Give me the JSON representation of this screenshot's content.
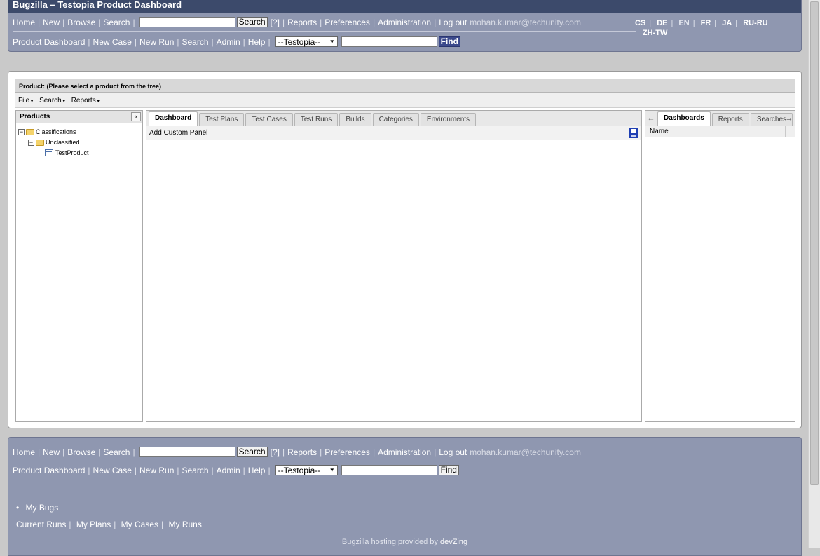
{
  "title": "Bugzilla – Testopia Product Dashboard",
  "nav": {
    "home": "Home",
    "new": "New",
    "browse": "Browse",
    "search": "Search",
    "search_button": "Search",
    "help": "[?]",
    "reports": "Reports",
    "preferences": "Preferences",
    "administration": "Administration",
    "logout": "Log out",
    "user": "mohan.kumar@techunity.com"
  },
  "testopia_nav": {
    "product_dashboard": "Product Dashboard",
    "new_case": "New Case",
    "new_run": "New Run",
    "search": "Search",
    "admin": "Admin",
    "help": "Help",
    "select_value": "--Testopia--",
    "find_button": "Find"
  },
  "languages": [
    "CS",
    "DE",
    "EN",
    "FR",
    "JA",
    "RU-RU",
    "ZH-TW"
  ],
  "product_header": "Product: (Please select a product from the tree)",
  "menu": {
    "file": "File",
    "search": "Search",
    "reports": "Reports"
  },
  "products_panel": {
    "title": "Products",
    "tree": {
      "root": "Classifications",
      "child": "Unclassified",
      "leaf": "TestProduct"
    }
  },
  "center_tabs": [
    "Dashboard",
    "Test Plans",
    "Test Cases",
    "Test Runs",
    "Builds",
    "Categories",
    "Environments"
  ],
  "center_toolbar": {
    "add_custom_panel": "Add Custom Panel"
  },
  "right_tabs": [
    "Dashboards",
    "Reports",
    "Searches"
  ],
  "right_grid": {
    "column_name": "Name"
  },
  "footer": {
    "my_bugs": "My Bugs",
    "current_runs": "Current Runs",
    "my_plans": "My Plans",
    "my_cases": "My Cases",
    "my_runs": "My Runs",
    "hosting_text": "Bugzilla hosting provided by",
    "hosting_brand": "devZing"
  }
}
